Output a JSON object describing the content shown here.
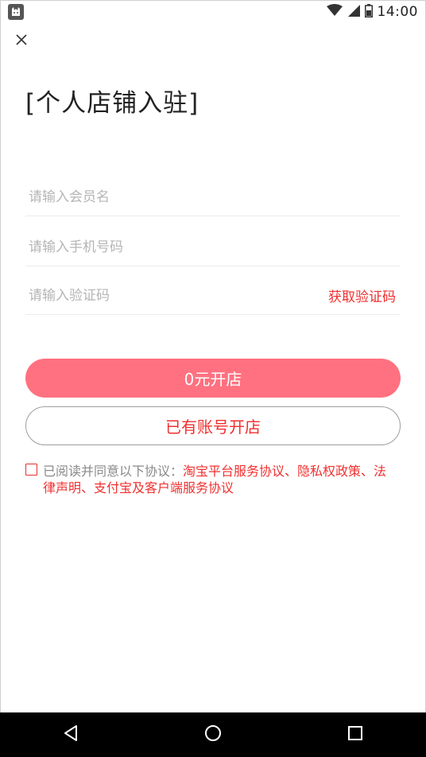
{
  "status_bar": {
    "time": "14:00"
  },
  "page": {
    "title": "[个人店铺入驻]"
  },
  "form": {
    "member_name_placeholder": "请输入会员名",
    "phone_placeholder": "请输入手机号码",
    "code_placeholder": "请输入验证码",
    "get_code_label": "获取验证码"
  },
  "buttons": {
    "open_free_label": "0元开店",
    "existing_account_label": "已有账号开店"
  },
  "agreement": {
    "prefix": "已阅读并同意以下协议：",
    "links": "淘宝平台服务协议、隐私权政策、法律声明、支付宝及客户端服务协议"
  },
  "icons": {
    "close": "close-icon",
    "wifi": "wifi-icon",
    "signal": "signal-icon",
    "battery": "battery-icon",
    "back": "back-icon",
    "home": "home-icon",
    "recents": "recents-icon"
  },
  "colors": {
    "accent": "#f0302f",
    "primary_button": "#ff7180"
  }
}
